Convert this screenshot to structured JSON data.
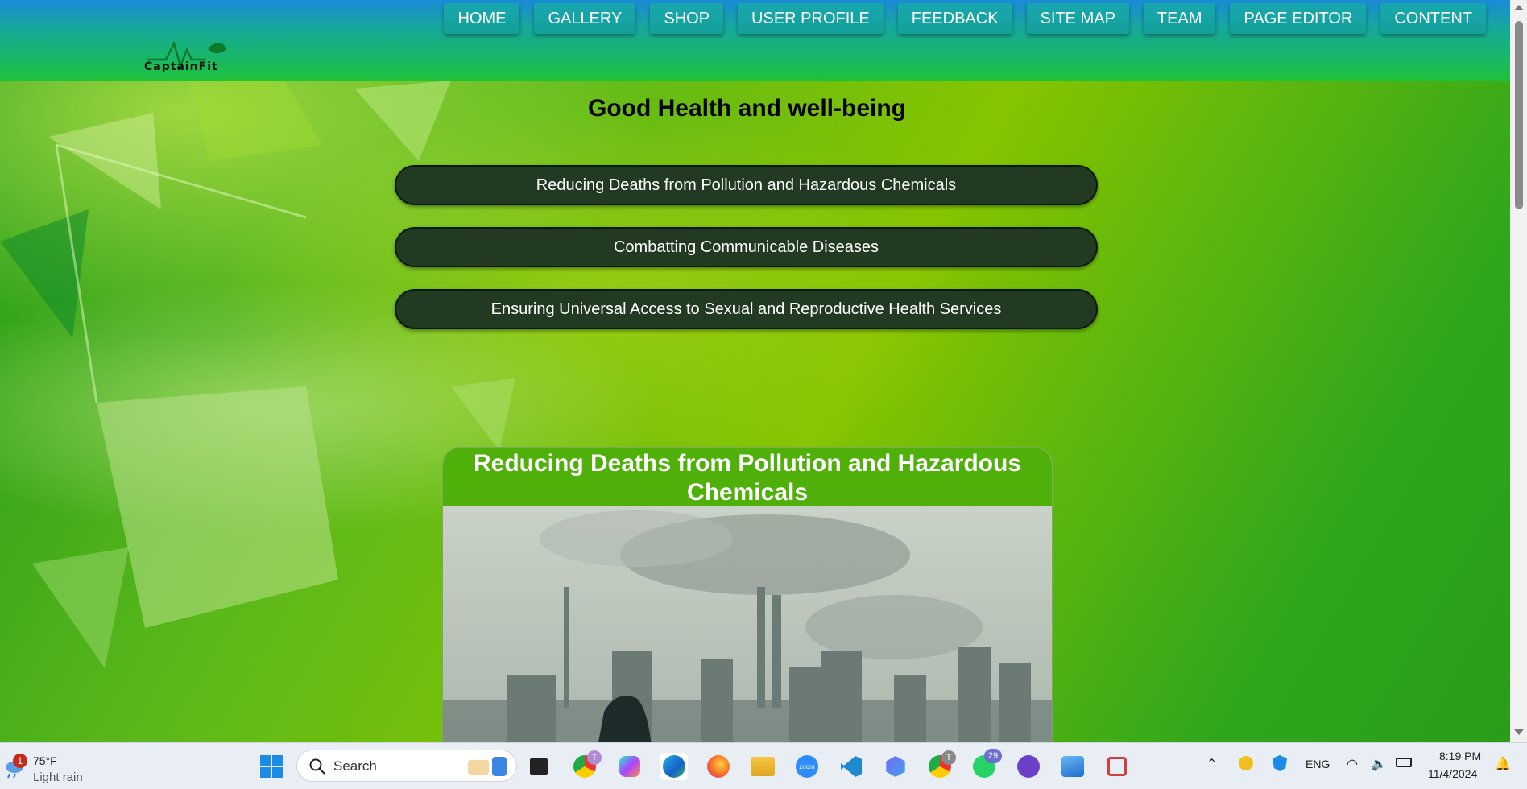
{
  "header": {
    "logo_text": "CaptainFit",
    "nav": [
      "HOME",
      "GALLERY",
      "SHOP",
      "USER PROFILE",
      "FEEDBACK",
      "SITE MAP",
      "TEAM",
      "PAGE EDITOR",
      "CONTENT"
    ]
  },
  "main": {
    "title": "Good Health and well-being",
    "buttons": [
      "Reducing Deaths from Pollution and Hazardous Chemicals",
      "Combatting Communicable Diseases",
      "Ensuring Universal Access to Sexual and Reproductive Health Services"
    ],
    "card": {
      "title": "Reducing Deaths from Pollution and Hazardous Chemicals"
    }
  },
  "taskbar": {
    "weather": {
      "badge": "1",
      "temp": "75°F",
      "condition": "Light rain"
    },
    "search_placeholder": "Search",
    "whatsapp_badge": "29",
    "chrome_badge_1": "T",
    "chrome_badge_2": "T",
    "tray": {
      "language": "ENG",
      "time": "8:19 PM",
      "date": "11/4/2024"
    }
  },
  "colors": {
    "accent": "#4fb00a",
    "pill": "#213a21",
    "nav": "#18a7b0"
  }
}
